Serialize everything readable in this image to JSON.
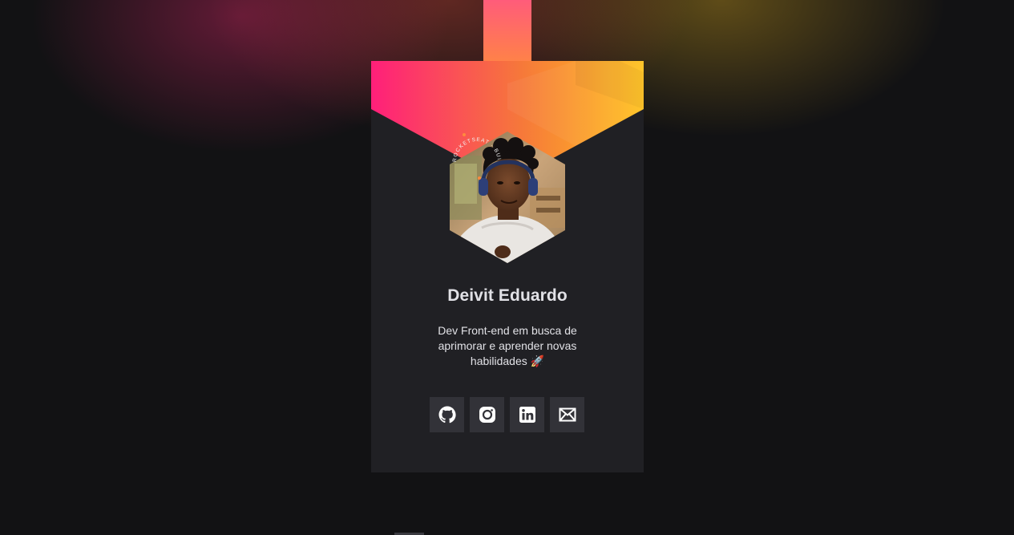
{
  "profile": {
    "name": "Deivit Eduardo",
    "bio": "Dev Front-end em busca de aprimorar e aprender novas habilidades 🚀",
    "badge_text": "ROCKETSEAT · BUILD THE FUTURE ·"
  },
  "social": [
    {
      "name": "github",
      "icon": "github-icon"
    },
    {
      "name": "instagram",
      "icon": "instagram-icon"
    },
    {
      "name": "linkedin",
      "icon": "linkedin-icon"
    },
    {
      "name": "email",
      "icon": "mail-icon"
    }
  ],
  "colors": {
    "background": "#121214",
    "card": "#202024",
    "button": "#323238",
    "text": "#e1e1e6",
    "gradient_start": "#ff1f7a",
    "gradient_mid": "#f6783a",
    "gradient_end": "#ffc21f"
  }
}
